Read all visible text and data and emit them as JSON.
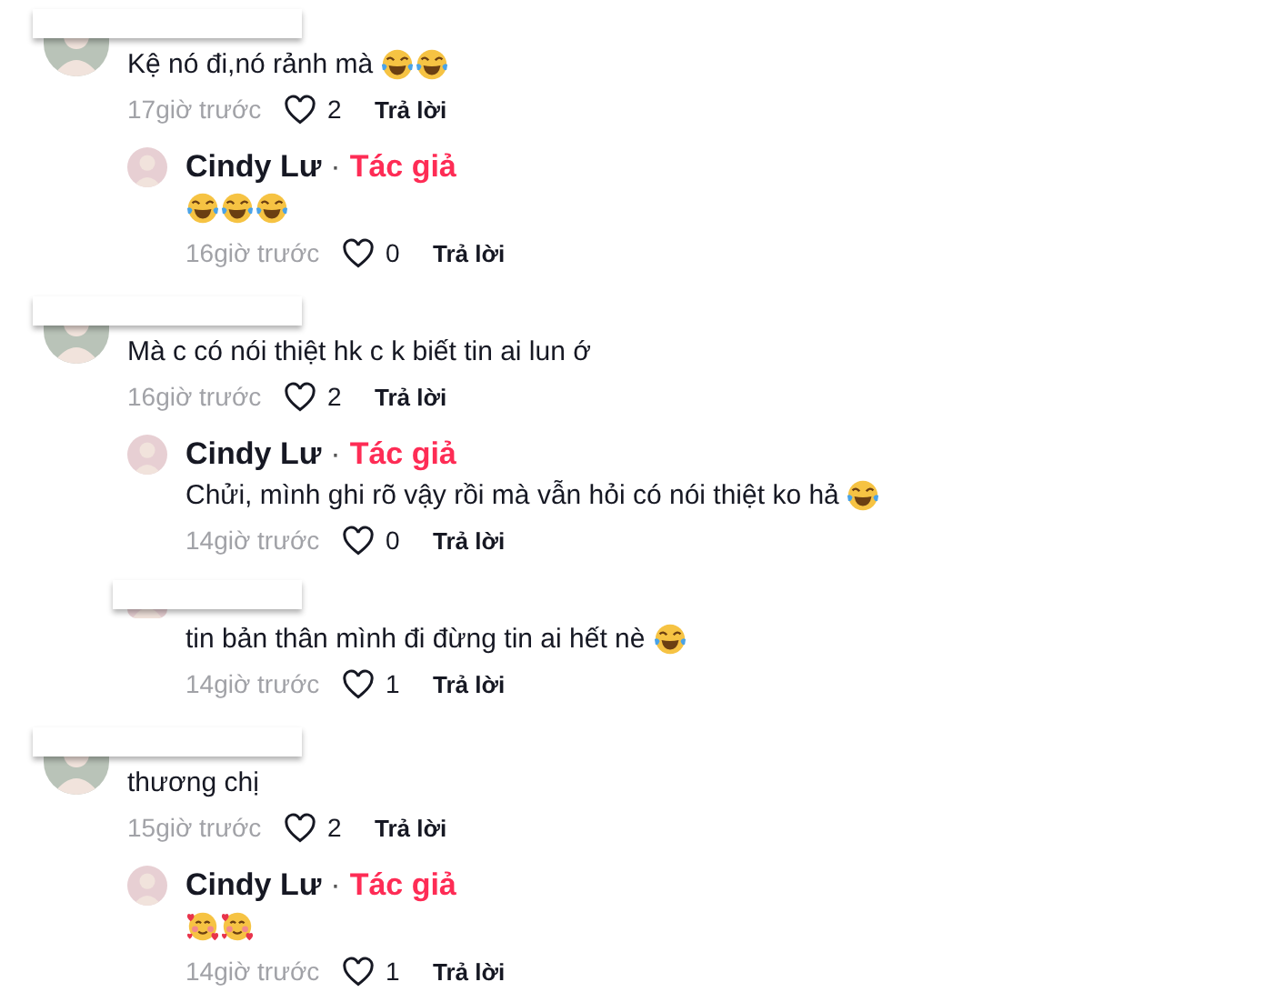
{
  "comments": [
    {
      "redacted": true,
      "text": "Kệ nó đi,nó rảnh mà",
      "emojis": [
        {
          "kind": "joy"
        },
        {
          "kind": "joy"
        }
      ],
      "time": "17giờ trước",
      "likes": "2",
      "reply_label": "Trả lời",
      "replies": [
        {
          "redacted": false,
          "author": "Cindy Lư",
          "separator": "·",
          "badge": "Tác giả",
          "emojis": [
            {
              "kind": "joy"
            },
            {
              "kind": "joy"
            },
            {
              "kind": "joy"
            }
          ],
          "time": "16giờ trước",
          "likes": "0",
          "reply_label": "Trả lời"
        }
      ]
    },
    {
      "redacted": true,
      "text": "Mà c có nói thiệt hk c k biết tin ai lun ớ",
      "time": "16giờ trước",
      "likes": "2",
      "reply_label": "Trả lời",
      "replies": [
        {
          "redacted": false,
          "author": "Cindy Lư",
          "separator": "·",
          "badge": "Tác giả",
          "text": "Chửi, mình ghi rõ vậy rồi mà vẫn hỏi có nói thiệt ko hả",
          "emojis": [
            {
              "kind": "joy"
            }
          ],
          "time": "14giờ trước",
          "likes": "0",
          "reply_label": "Trả lời"
        },
        {
          "redacted": true,
          "text": "tin bản thân mình đi đừng tin ai hết nè",
          "emojis": [
            {
              "kind": "joy"
            }
          ],
          "time": "14giờ trước",
          "likes": "1",
          "reply_label": "Trả lời"
        }
      ]
    },
    {
      "redacted": true,
      "text": "thương chị",
      "time": "15giờ trước",
      "likes": "2",
      "reply_label": "Trả lời",
      "replies": [
        {
          "redacted": false,
          "author": "Cindy Lư",
          "separator": "·",
          "badge": "Tác giả",
          "emojis": [
            {
              "kind": "hearts"
            },
            {
              "kind": "hearts"
            }
          ],
          "time": "14giờ trước",
          "likes": "1",
          "reply_label": "Trả lời"
        }
      ]
    }
  ]
}
